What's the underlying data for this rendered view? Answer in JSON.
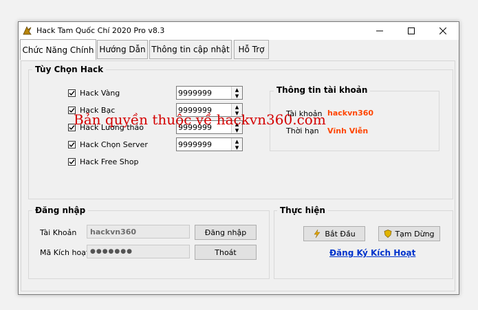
{
  "window": {
    "title": "Hack Tam Quốc Chí 2020 Pro v8.3",
    "minimize_glyph": "—",
    "maximize_glyph": "☐",
    "close_glyph": "✕"
  },
  "tabs": [
    {
      "label": "Chức Năng Chính",
      "active": true
    },
    {
      "label": "Hướng Dẫn",
      "active": false
    },
    {
      "label": "Thông tin cập nhật",
      "active": false
    },
    {
      "label": "Hỗ Trợ",
      "active": false
    }
  ],
  "hack_options": {
    "title": "Tùy Chọn Hack",
    "items": [
      {
        "label": "Hack Vàng",
        "checked": true,
        "value": "9999999"
      },
      {
        "label": "Hack Bạc",
        "checked": true,
        "value": "9999999"
      },
      {
        "label": "Hack Lương thảo",
        "checked": true,
        "value": "9999999"
      },
      {
        "label": "Hack Chọn Server",
        "checked": true,
        "value": "9999999"
      },
      {
        "label": "Hack Free Shop",
        "checked": true
      }
    ]
  },
  "account_info": {
    "title": "Thông tin tài khoản",
    "account_label": "Tài khoản",
    "account_value": "hackvn360",
    "duration_label": "Thời hạn",
    "duration_value": "Vĩnh Viễn"
  },
  "watermark": "Bản quyền thuộc về hackvn360.com",
  "login": {
    "title": "Đăng nhập",
    "account_label": "Tài Khoản",
    "account_value": "hackvn360",
    "code_label": "Mã Kích hoạt",
    "code_value": "●●●●●●●",
    "login_button": "Đăng nhập",
    "exit_button": "Thoát"
  },
  "action": {
    "title": "Thực hiện",
    "start_button": "Bắt Đầu",
    "pause_button": "Tạm Dừng",
    "register_link": "Đăng Ký Kích Hoạt"
  },
  "colors": {
    "accent_orange": "#ff4500",
    "watermark_red": "#d40000",
    "link_blue": "#0033cc"
  }
}
